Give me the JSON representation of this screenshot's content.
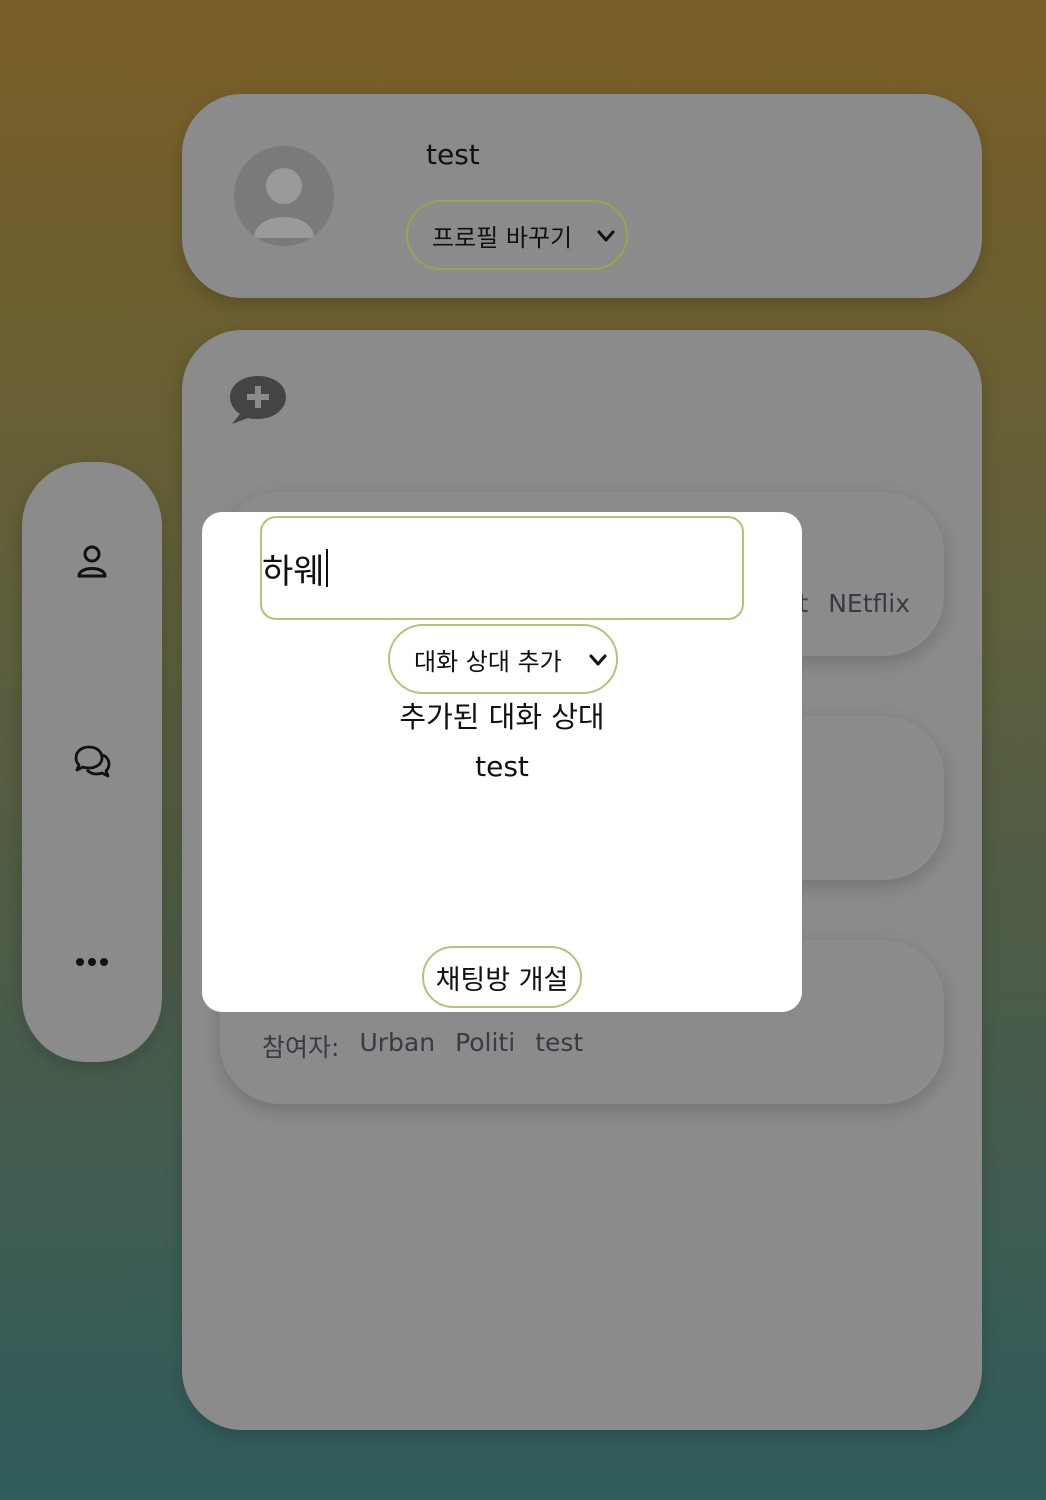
{
  "profile": {
    "username": "test",
    "profile_select": "프로필 바꾸기"
  },
  "chat_list": {
    "rooms": [
      {
        "participants": [
          "t",
          "NEtflix"
        ]
      },
      {
        "participants": []
      },
      {
        "participants_label": "참여자:",
        "participants": [
          "Urban",
          "Politi",
          "test"
        ]
      }
    ]
  },
  "side_nav": {
    "items": [
      "user-icon",
      "chat-bubbles-icon",
      "more-icon"
    ]
  },
  "modal": {
    "message_input_value": "하웨",
    "add_partner_select": "대화 상대 추가",
    "added_title": "추가된 대화 상대",
    "added_users": [
      "test"
    ],
    "open_button_label": "채팅방 개설"
  },
  "colors": {
    "card": "#8b8b8b",
    "accent_border": "#b8c07f",
    "modal_bg": "#ffffff"
  }
}
